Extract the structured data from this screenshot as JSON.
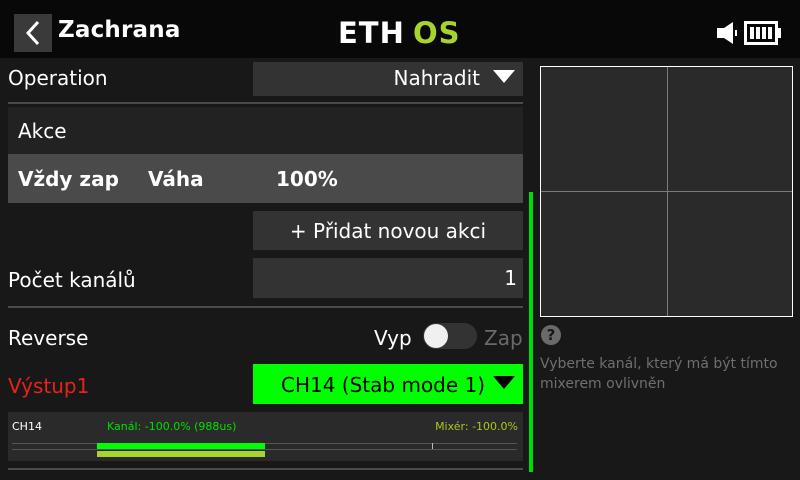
{
  "header": {
    "title": "Zachrana",
    "logo_prefix": "ETH",
    "logo_suffix": "OS",
    "logo_colors": {
      "prefix": "#ffffff",
      "suffix": "#a6d42c"
    },
    "back_icon": "chevron-left-icon",
    "speaker_icon": "speaker-icon",
    "battery_icon": "battery-icon"
  },
  "form": {
    "operation": {
      "label": "Operation",
      "value": "Nahradit"
    },
    "actions": {
      "section_label": "Akce",
      "items": [
        {
          "trigger": "Vždy zap",
          "weight_label": "Váha",
          "weight_value": "100%"
        }
      ],
      "add_button": "+ Přidat novou akci"
    },
    "channel_count": {
      "label": "Počet kanálů",
      "value": "1"
    },
    "reverse": {
      "label": "Reverse",
      "off_label": "Vyp",
      "on_label": "Zap",
      "state": "off"
    },
    "output": {
      "label": "Výstup1",
      "value": "CH14 (Stab mode 1)"
    }
  },
  "monitor": {
    "channel": "CH14",
    "channel_text": "Kanál: -100.0% (988us)",
    "mixer_text": "Mixér: -100.0%",
    "channel_percent": -100.0,
    "mixer_percent": -100.0,
    "colors": {
      "channel": "#00ff00",
      "mixer": "#a6d42c"
    }
  },
  "help": {
    "icon": "question-icon",
    "text": "Vyberte kanál, který má být tímto mixerem ovlivněn"
  },
  "colors": {
    "accent_green": "#00ff00",
    "error_red": "#e8221c",
    "field_bg": "#333333"
  }
}
